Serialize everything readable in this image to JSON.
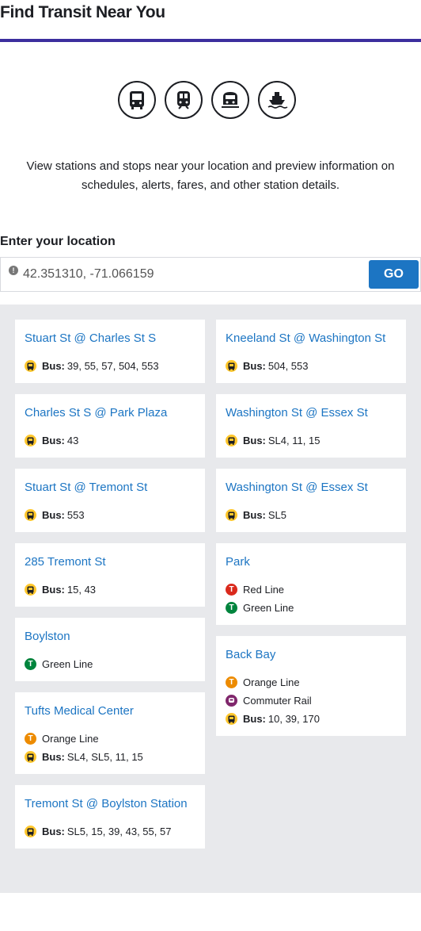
{
  "page": {
    "title": "Find Transit Near You",
    "intro": "View stations and stops near your location and preview information on schedules, alerts, fares, and other station details."
  },
  "modes": [
    {
      "icon": "bus-icon"
    },
    {
      "icon": "subway-icon"
    },
    {
      "icon": "commuter-rail-icon"
    },
    {
      "icon": "ferry-icon"
    }
  ],
  "location": {
    "label": "Enter your location",
    "value": "42.351310, -71.066159",
    "alert_icon": "!",
    "go_label": "GO"
  },
  "stops_left": [
    {
      "name": "Stuart St @ Charles St S",
      "routes": [
        {
          "type": "bus",
          "prefix": "Bus:",
          "text": "39, 55, 57, 504, 553"
        }
      ]
    },
    {
      "name": "Charles St S @ Park Plaza",
      "routes": [
        {
          "type": "bus",
          "prefix": "Bus:",
          "text": "43"
        }
      ]
    },
    {
      "name": "Stuart St @ Tremont St",
      "routes": [
        {
          "type": "bus",
          "prefix": "Bus:",
          "text": "553"
        }
      ]
    },
    {
      "name": "285 Tremont St",
      "routes": [
        {
          "type": "bus",
          "prefix": "Bus:",
          "text": "15, 43"
        }
      ]
    },
    {
      "name": "Boylston",
      "routes": [
        {
          "type": "green",
          "prefix": "",
          "text": "Green Line"
        }
      ]
    },
    {
      "name": "Tufts Medical Center",
      "routes": [
        {
          "type": "orange",
          "prefix": "",
          "text": "Orange Line"
        },
        {
          "type": "bus",
          "prefix": "Bus:",
          "text": "SL4, SL5, 11, 15"
        }
      ]
    },
    {
      "name": "Tremont St @ Boylston Station",
      "routes": [
        {
          "type": "bus",
          "prefix": "Bus:",
          "text": "SL5, 15, 39, 43, 55, 57"
        }
      ]
    }
  ],
  "stops_right": [
    {
      "name": "Kneeland St @ Washington St",
      "routes": [
        {
          "type": "bus",
          "prefix": "Bus:",
          "text": "504, 553"
        }
      ]
    },
    {
      "name": "Washington St @ Essex St",
      "routes": [
        {
          "type": "bus",
          "prefix": "Bus:",
          "text": "SL4, 11, 15"
        }
      ]
    },
    {
      "name": "Washington St @ Essex St",
      "routes": [
        {
          "type": "bus",
          "prefix": "Bus:",
          "text": "SL5"
        }
      ]
    },
    {
      "name": "Park",
      "routes": [
        {
          "type": "red",
          "prefix": "",
          "text": "Red Line"
        },
        {
          "type": "green",
          "prefix": "",
          "text": "Green Line"
        }
      ]
    },
    {
      "name": "Back Bay",
      "routes": [
        {
          "type": "orange",
          "prefix": "",
          "text": "Orange Line"
        },
        {
          "type": "cr",
          "prefix": "",
          "text": "Commuter Rail"
        },
        {
          "type": "bus",
          "prefix": "Bus:",
          "text": "10, 39, 170"
        }
      ]
    }
  ],
  "colors": {
    "brand": "#3c2e9e",
    "link": "#1c75c3",
    "bus": "#ffc72c",
    "red_line": "#da291c",
    "green_line": "#00843d",
    "orange_line": "#ed8b00",
    "commuter_rail": "#80276c"
  }
}
